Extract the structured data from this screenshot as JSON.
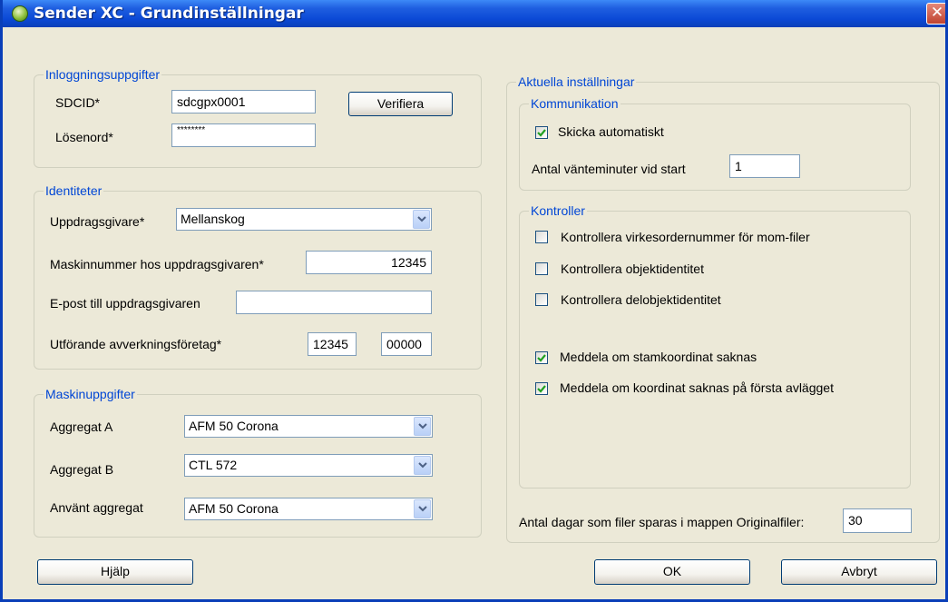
{
  "window": {
    "title": "Sender XC - Grundinställningar",
    "close_glyph": "✕"
  },
  "login": {
    "legend": "Inloggningsuppgifter",
    "sdcid_label": "SDCID*",
    "sdcid_value": "sdcgpx0001",
    "password_label": "Lösenord*",
    "password_value": "********",
    "verify_label": "Verifiera"
  },
  "identity": {
    "legend": "Identiteter",
    "client_label": "Uppdragsgivare*",
    "client_value": "Mellanskog",
    "machine_no_label": "Maskinnummer hos uppdragsgivaren*",
    "machine_no_value": "12345",
    "email_label": "E-post till uppdragsgivaren",
    "email_value": "",
    "contractor_label": "Utförande avverkningsföretag*",
    "contractor_value_1": "12345",
    "contractor_value_2": "00000"
  },
  "machine": {
    "legend": "Maskinuppgifter",
    "aggregat_a_label": "Aggregat A",
    "aggregat_a_value": "AFM 50 Corona",
    "aggregat_b_label": "Aggregat B",
    "aggregat_b_value": "CTL 572",
    "used_label": "Använt aggregat",
    "used_value": "AFM 50 Corona"
  },
  "current": {
    "legend": "Aktuella inställningar",
    "communication": {
      "legend": "Kommunikation",
      "auto_send_label": "Skicka automatiskt",
      "auto_send_checked": true,
      "wait_label": "Antal vänteminuter vid start",
      "wait_value": "1"
    },
    "checks": {
      "legend": "Kontroller",
      "items": [
        {
          "label": "Kontrollera virkesordernummer för mom-filer",
          "checked": false
        },
        {
          "label": "Kontrollera objektidentitet",
          "checked": false
        },
        {
          "label": "Kontrollera delobjektidentitet",
          "checked": false
        },
        {
          "label": "Meddela om stamkoordinat saknas",
          "checked": true
        },
        {
          "label": "Meddela om koordinat saknas på första avlägget",
          "checked": true
        }
      ]
    },
    "keep_days_label": "Antal dagar som filer sparas i mappen Originalfiler:",
    "keep_days_value": "30"
  },
  "buttons": {
    "help": "Hjälp",
    "ok": "OK",
    "cancel": "Avbryt"
  },
  "colors": {
    "title_bar": "#0a3fb8",
    "dialog_bg": "#ece9d8",
    "legend_text": "#0046d5",
    "check_mark": "#21a121"
  }
}
